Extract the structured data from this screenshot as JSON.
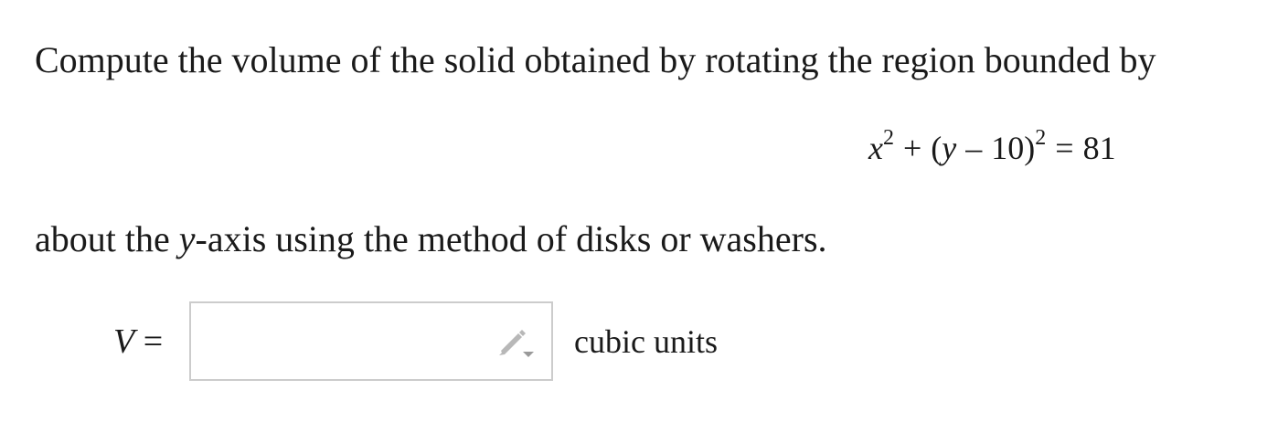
{
  "problem": {
    "prompt": "Compute the volume of the solid obtained by rotating the region bounded by",
    "equation": {
      "x_var": "x",
      "x_exp": "2",
      "plus": "+",
      "paren_open": "(",
      "y_var": "y",
      "minus": "–",
      "constant": "10",
      "paren_close": ")",
      "group_exp": "2",
      "equals": "=",
      "rhs": "81"
    },
    "method_before": "about the ",
    "axis_var": "y",
    "method_after": "-axis using the method of disks or washers."
  },
  "answer": {
    "label_var": "V",
    "label_equals": "=",
    "value": "",
    "units": "cubic units",
    "edit_icon": "pencil-icon"
  },
  "colors": {
    "text": "#1a1a1a",
    "input_border": "#cccccc",
    "icon": "#b8b8b8"
  }
}
